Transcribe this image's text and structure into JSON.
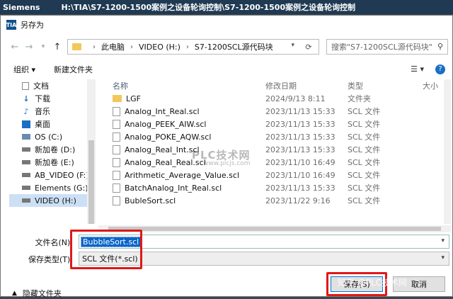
{
  "app": {
    "name": "Siemens",
    "path": "H:\\TIA\\S7-1200-1500案例之设备轮询控制\\S7-1200-1500案例之设备轮询控制"
  },
  "dialog": {
    "logo": "TIA",
    "title": "另存为"
  },
  "nav": {
    "breadcrumb": [
      "此电脑",
      "VIDEO (H:)",
      "S7-1200SCL源代码块"
    ],
    "search_placeholder": "搜索\"S7-1200SCL源代码块\""
  },
  "toolbar": {
    "organize": "组织 ▾",
    "new_folder": "新建文件夹"
  },
  "sidebar": {
    "items": [
      {
        "label": "文档",
        "icon": "document-icon"
      },
      {
        "label": "下载",
        "icon": "download-icon"
      },
      {
        "label": "音乐",
        "icon": "music-icon"
      },
      {
        "label": "桌面",
        "icon": "desktop-icon"
      },
      {
        "label": "OS (C:)",
        "icon": "drive-icon"
      },
      {
        "label": "新加卷 (D:)",
        "icon": "drive-icon"
      },
      {
        "label": "新加卷 (E:)",
        "icon": "drive-icon"
      },
      {
        "label": "AB_VIDEO (F:)",
        "icon": "drive-icon"
      },
      {
        "label": "Elements (G:)",
        "icon": "drive-icon"
      },
      {
        "label": "VIDEO (H:)",
        "icon": "drive-icon"
      }
    ]
  },
  "files": {
    "columns": {
      "name": "名称",
      "date": "修改日期",
      "type": "类型",
      "size": "大小"
    },
    "rows": [
      {
        "name": "LGF",
        "date": "2024/9/13 8:11",
        "type": "文件夹",
        "folder": true
      },
      {
        "name": "Analog_Int_Real.scl",
        "date": "2023/11/13 15:33",
        "type": "SCL 文件"
      },
      {
        "name": "Analog_PEEK_AIW.scl",
        "date": "2023/11/13 15:33",
        "type": "SCL 文件"
      },
      {
        "name": "Analog_POKE_AQW.scl",
        "date": "2023/11/13 15:33",
        "type": "SCL 文件"
      },
      {
        "name": "Analog_Real_Int.scl",
        "date": "2023/11/13 15:33",
        "type": "SCL 文件"
      },
      {
        "name": "Analog_Real_Real.scl",
        "date": "2023/11/10 16:49",
        "type": "SCL 文件"
      },
      {
        "name": "Arithmetic_Average_Value.scl",
        "date": "2023/11/10 16:49",
        "type": "SCL 文件"
      },
      {
        "name": "BatchAnalog_Int_Real.scl",
        "date": "2023/11/13 15:33",
        "type": "SCL 文件"
      },
      {
        "name": "BubleSort.scl",
        "date": "2023/11/22 9:16",
        "type": "SCL 文件"
      }
    ]
  },
  "form": {
    "filename_label": "文件名(N):",
    "filename_value": "BubbleSort.scl",
    "filetype_label": "保存类型(T):",
    "filetype_value": "SCL 文件(*.scl)"
  },
  "footer": {
    "hide_folders": "隐藏文件夹",
    "save": "保存(S)",
    "cancel": "取消"
  },
  "watermarks": {
    "center": "PLC技术网",
    "url": "www.plcjs.com",
    "corner": "知乎 @PLC技术网"
  }
}
